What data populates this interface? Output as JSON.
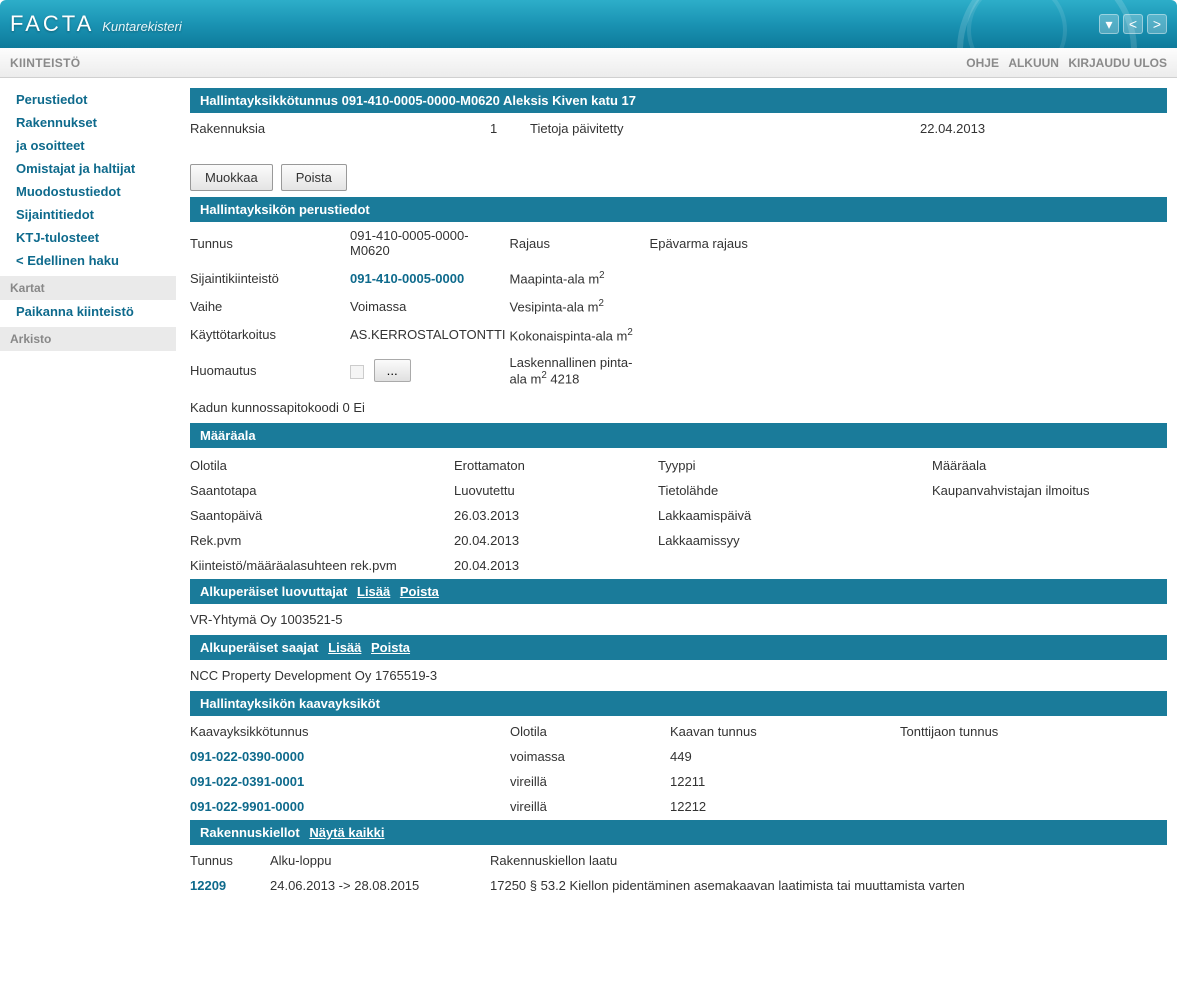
{
  "brand": "FACTA",
  "brand_sub": "Kuntarekisteri",
  "menu_left": "KIINTEISTÖ",
  "menu_right": {
    "help": "OHJE",
    "home": "ALKUUN",
    "logout": "KIRJAUDU ULOS"
  },
  "sidebar": {
    "items": [
      "Perustiedot",
      "Rakennukset",
      "ja osoitteet",
      "Omistajat ja haltijat",
      "Muodostustiedot",
      "Sijaintitiedot",
      "KTJ-tulosteet",
      "< Edellinen haku"
    ],
    "group_kartat": "Kartat",
    "paikanna": "Paikanna kiinteistö",
    "group_arkisto": "Arkisto"
  },
  "header_bar": "Hallintayksikkötunnus 091-410-0005-0000-M0620 Aleksis Kiven katu 17",
  "summary": {
    "label_rak": "Rakennuksia",
    "val_rak": "1",
    "label_paiv": "Tietoja päivitetty",
    "val_paiv": "22.04.2013"
  },
  "btn_edit": "Muokkaa",
  "btn_delete": "Poista",
  "section_perus": "Hallintayksikön perustiedot",
  "perus": {
    "tunnus_l": "Tunnus",
    "tunnus_v": "091-410-0005-0000-M0620",
    "rajaus_l": "Rajaus",
    "rajaus_v": "Epävarma rajaus",
    "sijk_l": "Sijaintikiinteistö",
    "sijk_v": "091-410-0005-0000",
    "maap_l": "Maapinta-ala m",
    "vaihe_l": "Vaihe",
    "vaihe_v": "Voimassa",
    "vesip_l": "Vesipinta-ala m",
    "kayt_l": "Käyttötarkoitus",
    "kayt_v": "AS.KERROSTALOTONTTI",
    "kokp_l": "Kokonaispinta-ala m",
    "huom_l": "Huomautus",
    "huom_btn": "...",
    "lask_l": "Laskennallinen pinta-ala m",
    "lask_v": "4218",
    "kadun": "Kadun kunnossapitokoodi 0   Ei"
  },
  "section_maara": "Määräala",
  "maara": {
    "olo_l": "Olotila",
    "olo_v": "Erottamaton",
    "tyy_l": "Tyyppi",
    "tyy_v": "Määräala",
    "saant_l": "Saantotapa",
    "saant_v": "Luovutettu",
    "tiet_l": "Tietolähde",
    "tiet_v": "Kaupanvahvistajan ilmoitus",
    "saanp_l": "Saantopäivä",
    "saanp_v": "26.03.2013",
    "lakk_l": "Lakkaamispäivä",
    "rek_l": "Rek.pvm",
    "rek_v": "20.04.2013",
    "laks_l": "Lakkaamissyy",
    "km_l": "Kiinteistö/määräalasuhteen rek.pvm",
    "km_v": "20.04.2013"
  },
  "section_luov": "Alkuperäiset luovuttajat",
  "luov_row": "VR-Yhtymä Oy 1003521-5",
  "section_saaj": "Alkuperäiset saajat",
  "saaj_row": "NCC Property Development Oy 1765519-3",
  "action_lisaa": "Lisää",
  "action_poista": "Poista",
  "section_kaava": "Hallintayksikön kaavayksiköt",
  "ky_head": {
    "c1": "Kaavayksikkötunnus",
    "c2": "Olotila",
    "c3": "Kaavan tunnus",
    "c4": "Tonttijaon tunnus"
  },
  "ky_rows": [
    {
      "c1": "091-022-0390-0000",
      "c2": "voimassa",
      "c3": "449",
      "c4": ""
    },
    {
      "c1": "091-022-0391-0001",
      "c2": "vireillä",
      "c3": "12211",
      "c4": ""
    },
    {
      "c1": "091-022-9901-0000",
      "c2": "vireillä",
      "c3": "12212",
      "c4": ""
    }
  ],
  "section_rk": "Rakennuskiellot",
  "action_nayta": "Näytä kaikki",
  "rk_head": {
    "c1": "Tunnus",
    "c2": "Alku-loppu",
    "c3": "Rakennuskiellon laatu"
  },
  "rk_rows": [
    {
      "c1": "12209",
      "c2": "24.06.2013 -> 28.08.2015",
      "c3": "17250 § 53.2 Kiellon pidentäminen asemakaavan laatimista tai muuttamista varten"
    }
  ]
}
